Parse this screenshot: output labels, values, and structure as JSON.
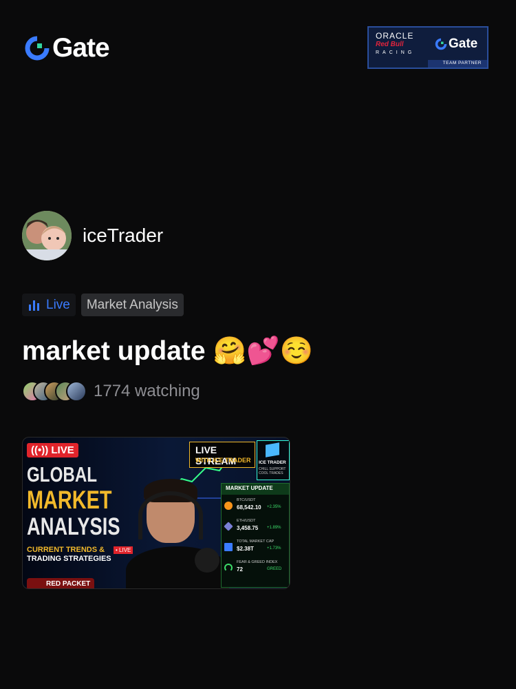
{
  "brand": {
    "logo_text": "Gate",
    "accent": "#3a7bff"
  },
  "partner_badge": {
    "oracle": "ORACLE",
    "redbull": "Red Bull",
    "racing": "RACING",
    "gate": "Gate",
    "team_partner": "TEAM PARTNER"
  },
  "streamer": {
    "name": "iceTrader"
  },
  "tags": {
    "live_label": "Live",
    "category": "Market Analysis"
  },
  "stream": {
    "title": "market update",
    "title_emojis": "🤗💕☺️",
    "viewers": "1774 watching"
  },
  "thumbnail": {
    "live_badge": "((•)) LIVE",
    "line1": "GLOBAL",
    "line2": "MARKET",
    "line3": "ANALYSIS",
    "subtitle1": "CURRENT TRENDS &",
    "subtitle2": "TRADING STRATEGIES",
    "mini_live": "• LIVE",
    "red_packet": "RED PACKET",
    "stream_title": "LIVE STREAM",
    "stream_subtitle": "WITH ICE TRADER",
    "ice_title": "ICE TRADER",
    "ice_sub1": "CHILL SUPPORT",
    "ice_sub2": "COOL TRADES",
    "panel_title": "MARKET UPDATE",
    "rows": [
      {
        "label": "BTC/USDT",
        "value": "68,542.10",
        "change": "+2.35%",
        "icon_color": "#f7931a"
      },
      {
        "label": "ETH/USDT",
        "value": "3,458.75",
        "change": "+1.89%",
        "icon_color": "#7a7fd6"
      },
      {
        "label": "TOTAL MARKET CAP",
        "value": "$2.38T",
        "change": "+1.73%",
        "icon_color": "#3a7bff"
      },
      {
        "label": "FEAR & GREED INDEX",
        "value": "72",
        "change": "GREED",
        "icon_color": "#3ddc6a"
      }
    ]
  }
}
